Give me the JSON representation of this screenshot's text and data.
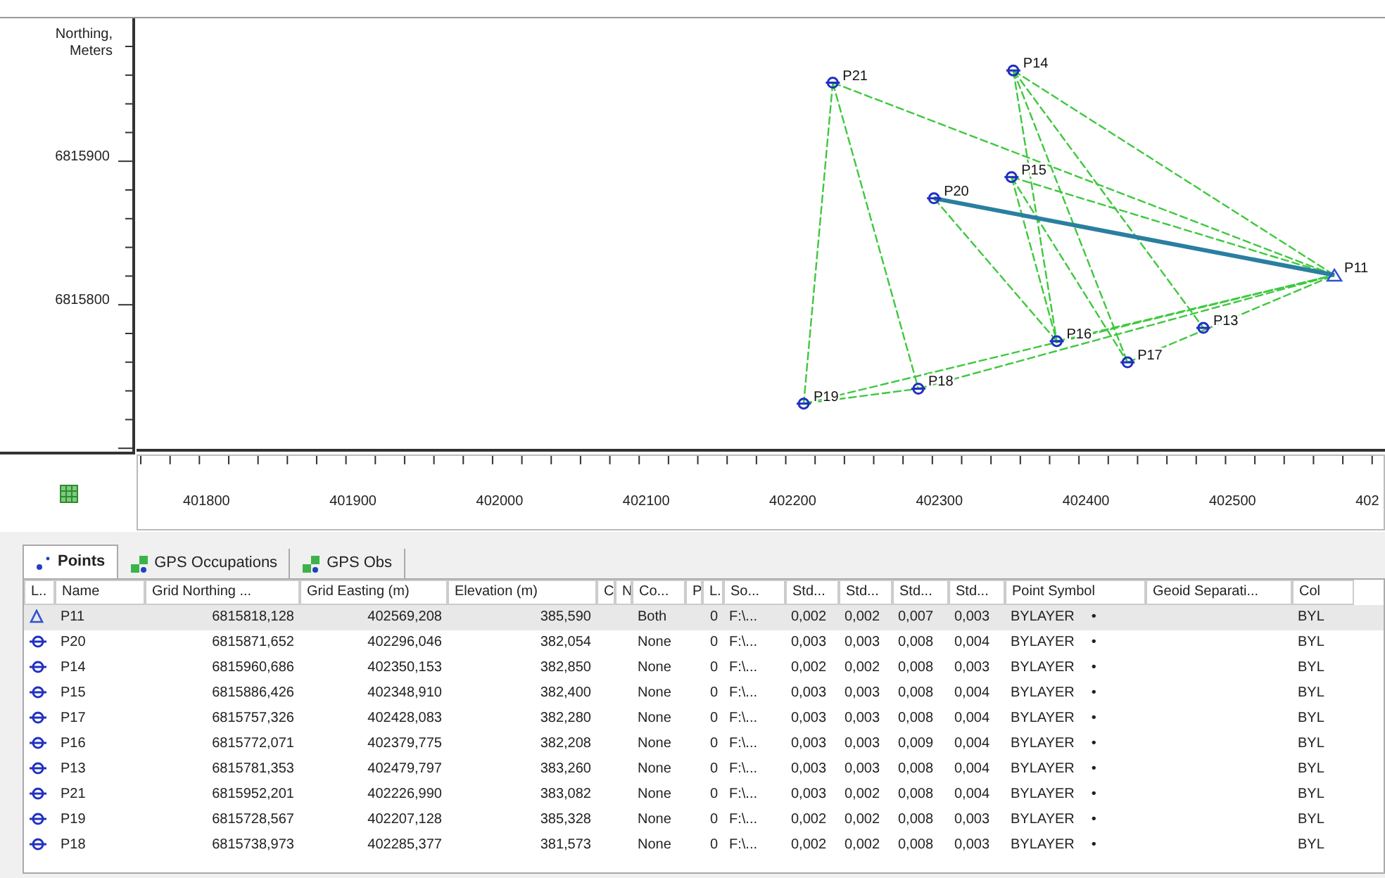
{
  "plot": {
    "y_axis_title": "Northing, Meters",
    "y_ticks": [
      "6815900",
      "6815800"
    ],
    "x_ticks": [
      "401800",
      "401900",
      "402000",
      "402100",
      "402200",
      "402300",
      "402400",
      "402500",
      "402"
    ],
    "point_labels": [
      "P11",
      "P20",
      "P14",
      "P15",
      "P17",
      "P16",
      "P13",
      "P21",
      "P19",
      "P18"
    ]
  },
  "tabs": [
    {
      "label": "Points",
      "selected": true
    },
    {
      "label": "GPS Occupations",
      "selected": false
    },
    {
      "label": "GPS Obs",
      "selected": false
    }
  ],
  "table": {
    "columns": [
      "L..",
      "Name",
      "Grid Northing ...",
      "Grid Easting (m)",
      "Elevation (m)",
      "C",
      "N",
      "Co...",
      "P",
      "L.",
      "So...",
      "Std...",
      "Std...",
      "Std...",
      "Std...",
      "Point Symbol",
      "Geoid Separati...",
      "Col"
    ],
    "rows": [
      {
        "kind": "control",
        "selected": true,
        "name": "P11",
        "northing": "6815818,128",
        "easting": "402569,208",
        "elevation": "385,590",
        "control": "Both",
        "column_10": "0",
        "source": "F:\\...",
        "std": [
          "0,002",
          "0,002",
          "0,007",
          "0,003"
        ],
        "symbol": "BYLAYER",
        "symbol_mark": "•",
        "column_18": "BYL"
      },
      {
        "kind": "gps",
        "selected": false,
        "name": "P20",
        "northing": "6815871,652",
        "easting": "402296,046",
        "elevation": "382,054",
        "control": "None",
        "column_10": "0",
        "source": "F:\\...",
        "std": [
          "0,003",
          "0,003",
          "0,008",
          "0,004"
        ],
        "symbol": "BYLAYER",
        "symbol_mark": "•",
        "column_18": "BYL"
      },
      {
        "kind": "gps",
        "selected": false,
        "name": "P14",
        "northing": "6815960,686",
        "easting": "402350,153",
        "elevation": "382,850",
        "control": "None",
        "column_10": "0",
        "source": "F:\\...",
        "std": [
          "0,002",
          "0,002",
          "0,008",
          "0,003"
        ],
        "symbol": "BYLAYER",
        "symbol_mark": "•",
        "column_18": "BYL"
      },
      {
        "kind": "gps",
        "selected": false,
        "name": "P15",
        "northing": "6815886,426",
        "easting": "402348,910",
        "elevation": "382,400",
        "control": "None",
        "column_10": "0",
        "source": "F:\\...",
        "std": [
          "0,003",
          "0,003",
          "0,008",
          "0,004"
        ],
        "symbol": "BYLAYER",
        "symbol_mark": "•",
        "column_18": "BYL"
      },
      {
        "kind": "gps",
        "selected": false,
        "name": "P17",
        "northing": "6815757,326",
        "easting": "402428,083",
        "elevation": "382,280",
        "control": "None",
        "column_10": "0",
        "source": "F:\\...",
        "std": [
          "0,003",
          "0,003",
          "0,008",
          "0,004"
        ],
        "symbol": "BYLAYER",
        "symbol_mark": "•",
        "column_18": "BYL"
      },
      {
        "kind": "gps",
        "selected": false,
        "name": "P16",
        "northing": "6815772,071",
        "easting": "402379,775",
        "elevation": "382,208",
        "control": "None",
        "column_10": "0",
        "source": "F:\\...",
        "std": [
          "0,003",
          "0,003",
          "0,009",
          "0,004"
        ],
        "symbol": "BYLAYER",
        "symbol_mark": "•",
        "column_18": "BYL"
      },
      {
        "kind": "gps",
        "selected": false,
        "name": "P13",
        "northing": "6815781,353",
        "easting": "402479,797",
        "elevation": "383,260",
        "control": "None",
        "column_10": "0",
        "source": "F:\\...",
        "std": [
          "0,003",
          "0,003",
          "0,008",
          "0,004"
        ],
        "symbol": "BYLAYER",
        "symbol_mark": "•",
        "column_18": "BYL"
      },
      {
        "kind": "gps",
        "selected": false,
        "name": "P21",
        "northing": "6815952,201",
        "easting": "402226,990",
        "elevation": "383,082",
        "control": "None",
        "column_10": "0",
        "source": "F:\\...",
        "std": [
          "0,003",
          "0,002",
          "0,008",
          "0,004"
        ],
        "symbol": "BYLAYER",
        "symbol_mark": "•",
        "column_18": "BYL"
      },
      {
        "kind": "gps",
        "selected": false,
        "name": "P19",
        "northing": "6815728,567",
        "easting": "402207,128",
        "elevation": "385,328",
        "control": "None",
        "column_10": "0",
        "source": "F:\\...",
        "std": [
          "0,002",
          "0,002",
          "0,008",
          "0,003"
        ],
        "symbol": "BYLAYER",
        "symbol_mark": "•",
        "column_18": "BYL"
      },
      {
        "kind": "gps",
        "selected": false,
        "name": "P18",
        "northing": "6815738,973",
        "easting": "402285,377",
        "elevation": "381,573",
        "control": "None",
        "column_10": "0",
        "source": "F:\\...",
        "std": [
          "0,002",
          "0,002",
          "0,008",
          "0,003"
        ],
        "symbol": "BYLAYER",
        "symbol_mark": "•",
        "column_18": "BYL"
      }
    ]
  }
}
